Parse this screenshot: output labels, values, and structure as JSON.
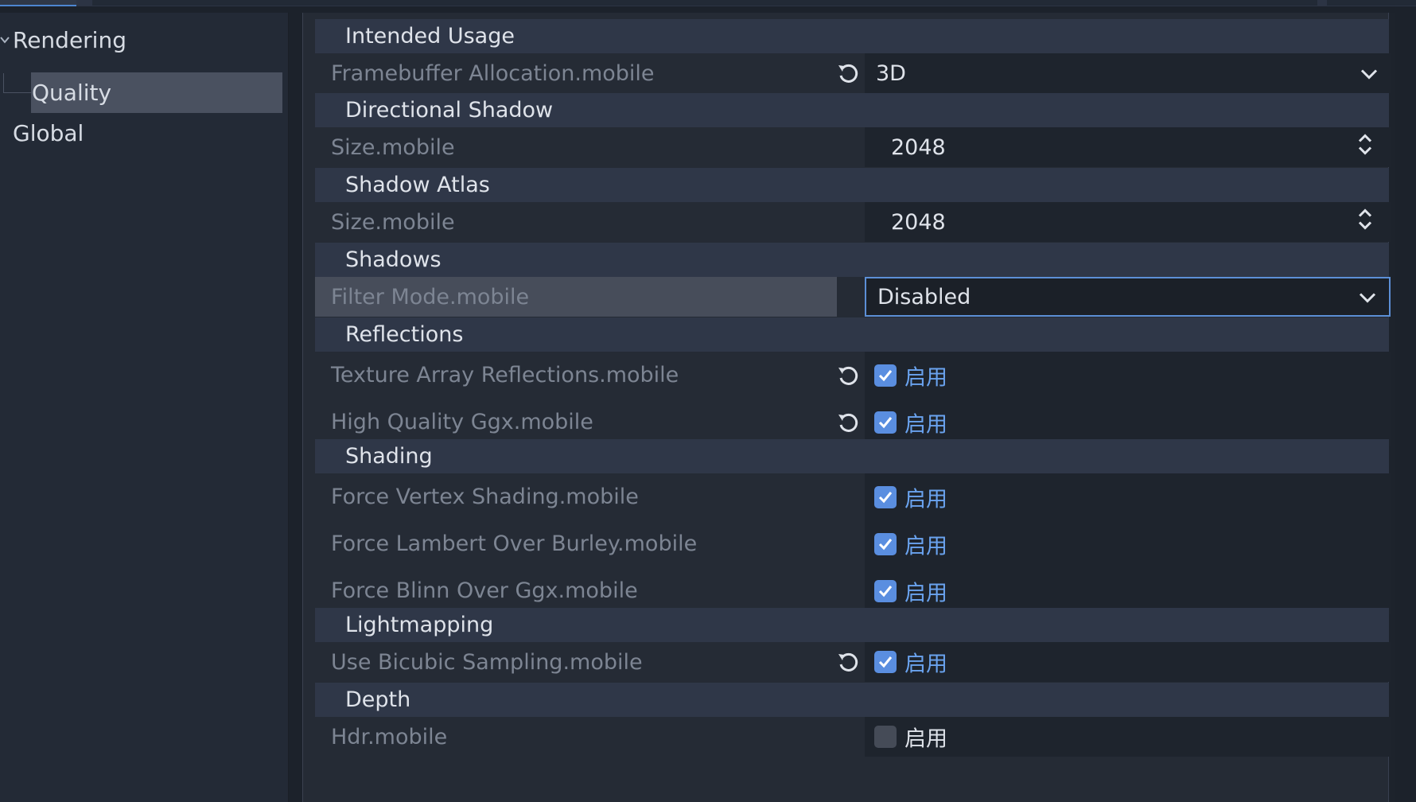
{
  "sidebar": {
    "items": [
      {
        "label": "Rendering"
      },
      {
        "label": "Quality"
      },
      {
        "label": "Global"
      }
    ]
  },
  "inspector": {
    "sections": {
      "intended_usage": "Intended Usage",
      "directional_shadow": "Directional Shadow",
      "shadow_atlas": "Shadow Atlas",
      "shadows": "Shadows",
      "reflections": "Reflections",
      "shading": "Shading",
      "lightmapping": "Lightmapping",
      "depth": "Depth"
    },
    "props": {
      "framebuffer_allocation": {
        "label": "Framebuffer Allocation.mobile",
        "value": "3D"
      },
      "dir_shadow_size": {
        "label": "Size.mobile",
        "value": "2048"
      },
      "atlas_size": {
        "label": "Size.mobile",
        "value": "2048"
      },
      "filter_mode": {
        "label": "Filter Mode.mobile",
        "value": "Disabled"
      },
      "texture_array_reflections": {
        "label": "Texture Array Reflections.mobile",
        "checked": true,
        "check_label": "启用"
      },
      "high_quality_ggx": {
        "label": "High Quality Ggx.mobile",
        "checked": true,
        "check_label": "启用"
      },
      "force_vertex_shading": {
        "label": "Force Vertex Shading.mobile",
        "checked": true,
        "check_label": "启用"
      },
      "force_lambert": {
        "label": "Force Lambert Over Burley.mobile",
        "checked": true,
        "check_label": "启用"
      },
      "force_blinn": {
        "label": "Force Blinn Over Ggx.mobile",
        "checked": true,
        "check_label": "启用"
      },
      "bicubic_sampling": {
        "label": "Use Bicubic Sampling.mobile",
        "checked": true,
        "check_label": "启用"
      },
      "hdr": {
        "label": "Hdr.mobile",
        "checked": false,
        "check_label": "启用"
      }
    }
  },
  "colors": {
    "accent": "#5a8ee0",
    "check_label": "#6aa3ef",
    "focus_border": "#5c8fd6"
  }
}
